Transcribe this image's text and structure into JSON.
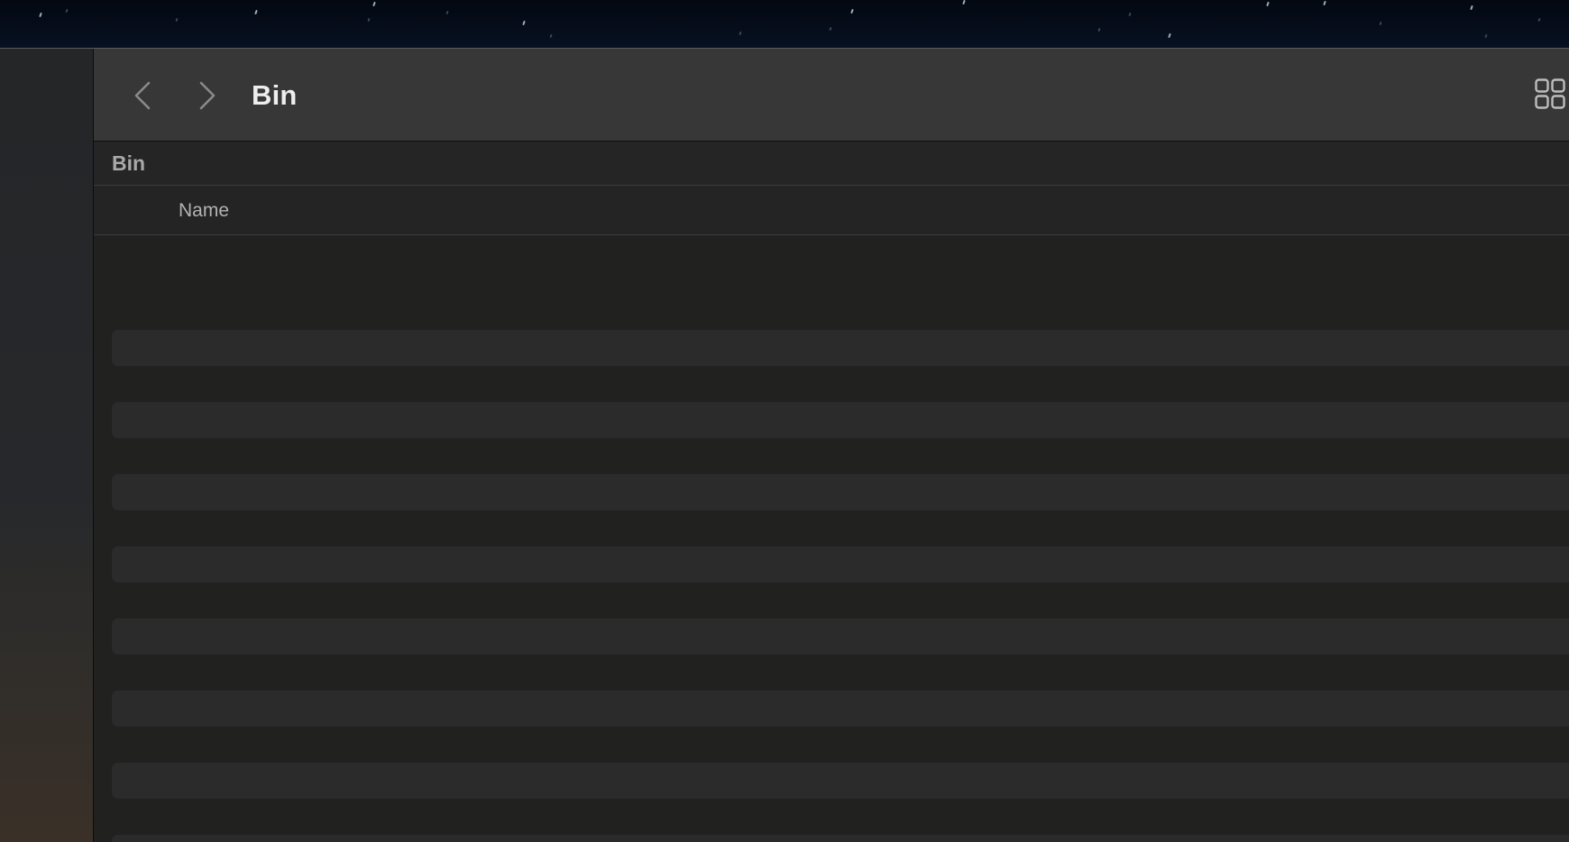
{
  "window": {
    "title": "Bin"
  },
  "toolbar": {
    "back_icon": "chevron-left-icon",
    "forward_icon": "chevron-right-icon",
    "view_icon": "grid-view-icon"
  },
  "location": {
    "label": "Bin"
  },
  "columns": {
    "name": "Name"
  },
  "colors": {
    "toolbar_bg": "#383738",
    "content_bg": "#212120",
    "stripe_row": "#2b2b2b",
    "title_text": "#eeeeee",
    "secondary_text": "#a9a9a9"
  }
}
